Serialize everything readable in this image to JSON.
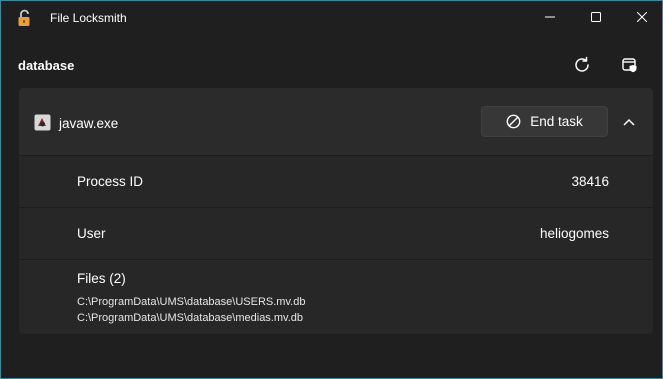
{
  "window": {
    "title": "File Locksmith"
  },
  "header": {
    "title": "database"
  },
  "process": {
    "name": "javaw.exe",
    "end_task_label": "End task",
    "pid_label": "Process ID",
    "pid_value": "38416",
    "user_label": "User",
    "user_value": "heliogomes",
    "files_label": "Files (2)",
    "files": [
      "C:\\ProgramData\\UMS\\database\\USERS.mv.db",
      "C:\\ProgramData\\UMS\\database\\medias.mv.db"
    ]
  },
  "colors": {
    "accent_border": "#3a8a9a",
    "lock_icon": "#e8a03a"
  },
  "icons": {
    "app": "padlock-icon",
    "minimize": "minimize-icon",
    "maximize": "maximize-icon",
    "close": "close-icon",
    "refresh": "refresh-icon",
    "admin": "shield-window-icon",
    "process": "java-process-icon",
    "end_task": "block-icon",
    "collapse": "chevron-up-icon"
  }
}
